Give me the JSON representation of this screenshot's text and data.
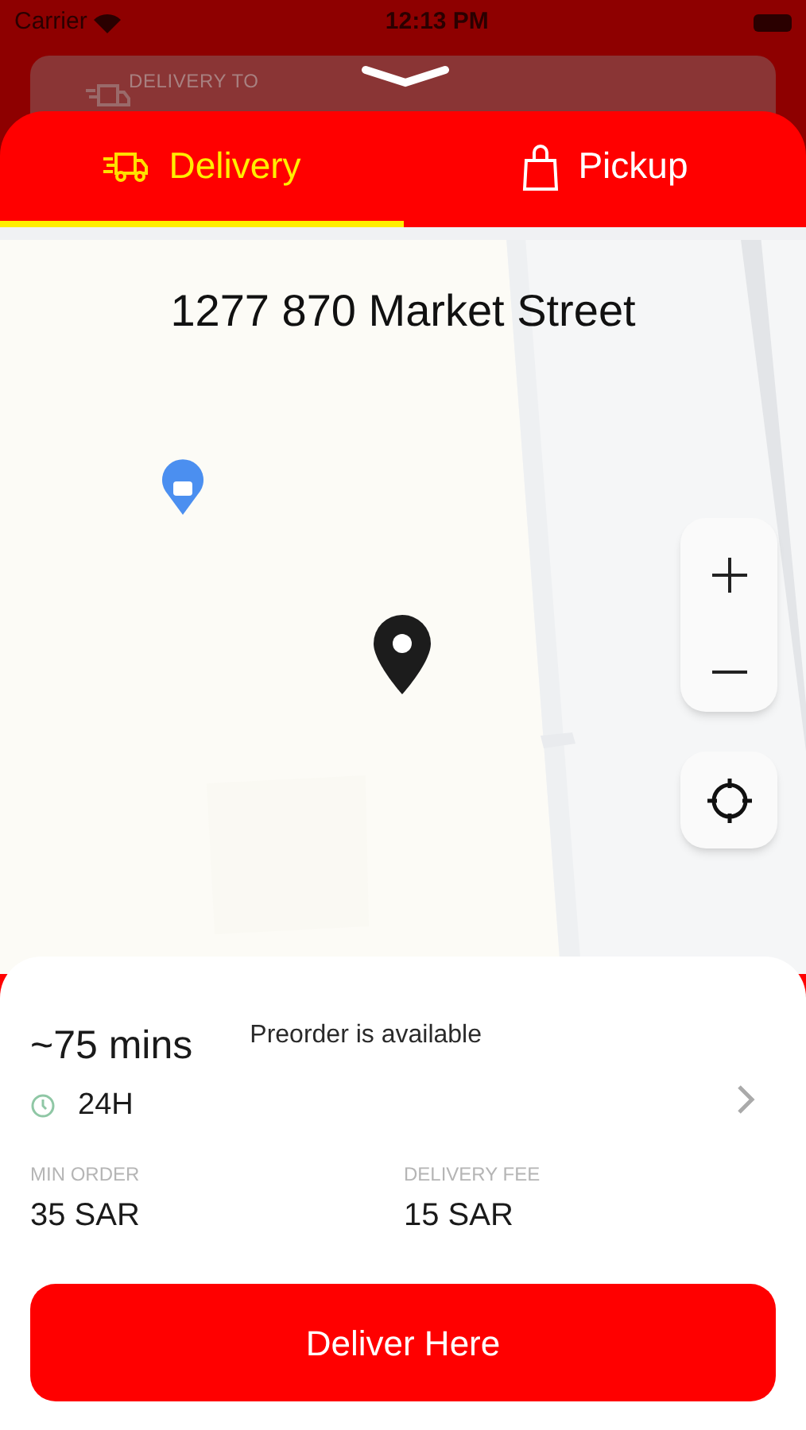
{
  "status_bar": {
    "carrier": "Carrier",
    "time": "12:13 PM"
  },
  "background_card": {
    "label": "DELIVERY TO"
  },
  "tabs": [
    {
      "label": "Delivery",
      "kind": "delivery",
      "selected": true
    },
    {
      "label": "Pickup",
      "kind": "pickup",
      "selected": false
    }
  ],
  "map": {
    "address": "1277 870 Market Street"
  },
  "info": {
    "eta": "~75 mins",
    "preorder": "Preorder is available",
    "hours": "24H",
    "stats": [
      {
        "label": "MIN ORDER",
        "value": "35 SAR"
      },
      {
        "label": "DELIVERY FEE",
        "value": "15 SAR"
      }
    ]
  },
  "action_button": "Deliver Here"
}
